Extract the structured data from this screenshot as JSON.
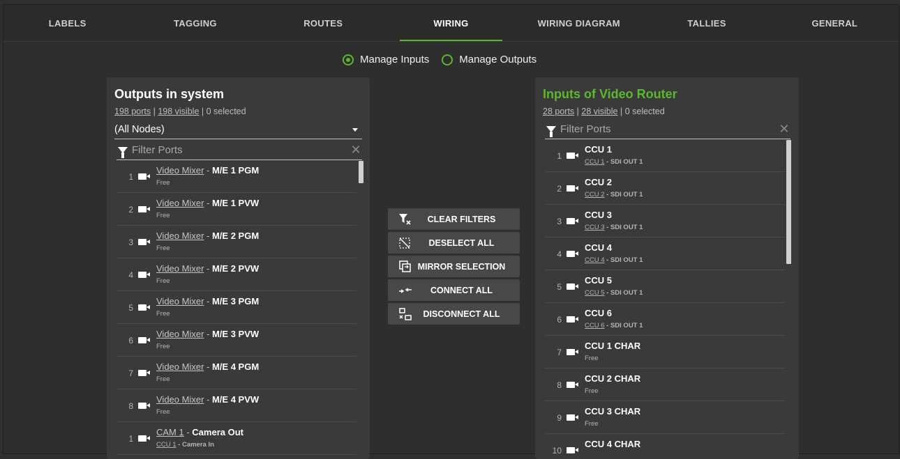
{
  "tabs": [
    {
      "label": "LABELS",
      "active": false
    },
    {
      "label": "TAGGING",
      "active": false
    },
    {
      "label": "ROUTES",
      "active": false
    },
    {
      "label": "WIRING",
      "active": true
    },
    {
      "label": "WIRING DIAGRAM",
      "active": false
    },
    {
      "label": "TALLIES",
      "active": false
    },
    {
      "label": "GENERAL",
      "active": false
    }
  ],
  "mode": {
    "inputs_label": "Manage Inputs",
    "outputs_label": "Manage Outputs",
    "selected": "inputs"
  },
  "colors": {
    "accent": "#5ab82e",
    "panel": "#3a3a3a",
    "background": "#2f2f2f"
  },
  "left": {
    "title": "Outputs in system",
    "ports": "198 ports",
    "visible": "198 visible",
    "selected": " | 0 selected",
    "node_select": "(All Nodes)",
    "filter_placeholder": "Filter Ports",
    "rows": [
      {
        "num": "1",
        "link": "Video Mixer",
        "name": "M/E 1 PGM",
        "sub": "Free"
      },
      {
        "num": "2",
        "link": "Video Mixer",
        "name": "M/E 1 PVW",
        "sub": "Free"
      },
      {
        "num": "3",
        "link": "Video Mixer",
        "name": "M/E 2 PGM",
        "sub": "Free"
      },
      {
        "num": "4",
        "link": "Video Mixer",
        "name": "M/E 2 PVW",
        "sub": "Free"
      },
      {
        "num": "5",
        "link": "Video Mixer",
        "name": "M/E 3 PGM",
        "sub": "Free"
      },
      {
        "num": "6",
        "link": "Video Mixer",
        "name": "M/E 3 PVW",
        "sub": "Free"
      },
      {
        "num": "7",
        "link": "Video Mixer",
        "name": "M/E 4 PGM",
        "sub": "Free"
      },
      {
        "num": "8",
        "link": "Video Mixer",
        "name": "M/E 4 PVW",
        "sub": "Free"
      },
      {
        "num": "1",
        "link": "CAM 1",
        "name": "Camera Out",
        "sub_link": "CCU 1",
        "sub_rest": " - Camera In"
      }
    ]
  },
  "right": {
    "title": "Inputs of Video Router",
    "ports": "28 ports",
    "visible": "28 visible",
    "selected": " | 0 selected",
    "filter_placeholder": "Filter Ports",
    "rows": [
      {
        "num": "1",
        "name": "CCU 1",
        "sub_link": "CCU 1",
        "sub_rest": " - SDI OUT 1"
      },
      {
        "num": "2",
        "name": "CCU 2",
        "sub_link": "CCU 2",
        "sub_rest": " - SDI OUT 1"
      },
      {
        "num": "3",
        "name": "CCU 3",
        "sub_link": "CCU 3",
        "sub_rest": " - SDI OUT 1"
      },
      {
        "num": "4",
        "name": "CCU 4",
        "sub_link": "CCU 4",
        "sub_rest": " - SDI OUT 1"
      },
      {
        "num": "5",
        "name": "CCU 5",
        "sub_link": "CCU 5",
        "sub_rest": " - SDI OUT 1"
      },
      {
        "num": "6",
        "name": "CCU 6",
        "sub_link": "CCU 6",
        "sub_rest": " - SDI OUT 1"
      },
      {
        "num": "7",
        "name": "CCU 1 CHAR",
        "sub": "Free"
      },
      {
        "num": "8",
        "name": "CCU 2 CHAR",
        "sub": "Free"
      },
      {
        "num": "9",
        "name": "CCU 3 CHAR",
        "sub": "Free"
      },
      {
        "num": "10",
        "name": "CCU 4 CHAR",
        "sub": ""
      }
    ]
  },
  "actions": [
    {
      "label": "CLEAR FILTERS",
      "icon": "clear-filter-icon"
    },
    {
      "label": "DESELECT ALL",
      "icon": "deselect-icon"
    },
    {
      "label": "MIRROR SELECTION",
      "icon": "mirror-icon"
    },
    {
      "label": "CONNECT ALL",
      "icon": "connect-icon"
    },
    {
      "label": "DISCONNECT ALL",
      "icon": "disconnect-icon"
    }
  ]
}
